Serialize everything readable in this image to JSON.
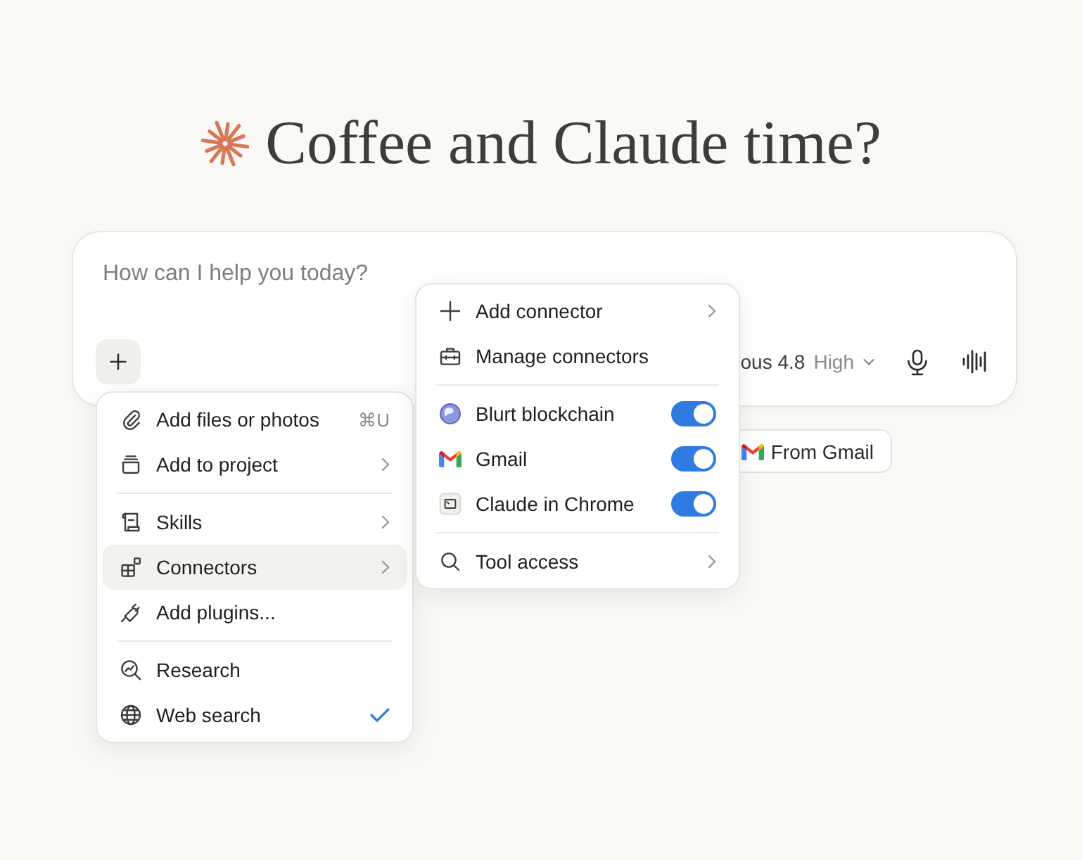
{
  "heading": {
    "title": "Coffee and Claude time?"
  },
  "composer": {
    "placeholder": "How can I help you today?",
    "model": "ous 4.8",
    "effort": "High"
  },
  "suggestions": [
    {
      "label": "From Gmail"
    }
  ],
  "add_menu": {
    "sections": [
      {
        "items": [
          {
            "label": "Add files or photos",
            "shortcut": "⌘U",
            "submenu": false,
            "selected": false
          },
          {
            "label": "Add to project",
            "submenu": true,
            "selected": false
          }
        ]
      },
      {
        "items": [
          {
            "label": "Skills",
            "submenu": true,
            "selected": false
          },
          {
            "label": "Connectors",
            "submenu": true,
            "selected": true
          },
          {
            "label": "Add plugins...",
            "submenu": false,
            "selected": false
          }
        ]
      },
      {
        "items": [
          {
            "label": "Research",
            "checked": false,
            "selected": false
          },
          {
            "label": "Web search",
            "checked": true,
            "selected": false
          }
        ]
      }
    ]
  },
  "connectors_menu": {
    "sections": [
      {
        "items": [
          {
            "label": "Add connector",
            "submenu": true
          },
          {
            "label": "Manage connectors",
            "submenu": false
          }
        ]
      },
      {
        "items": [
          {
            "label": "Blurt blockchain",
            "on": true
          },
          {
            "label": "Gmail",
            "on": true
          },
          {
            "label": "Claude in Chrome",
            "on": true
          }
        ]
      },
      {
        "items": [
          {
            "label": "Tool access",
            "submenu": true
          }
        ]
      }
    ]
  }
}
